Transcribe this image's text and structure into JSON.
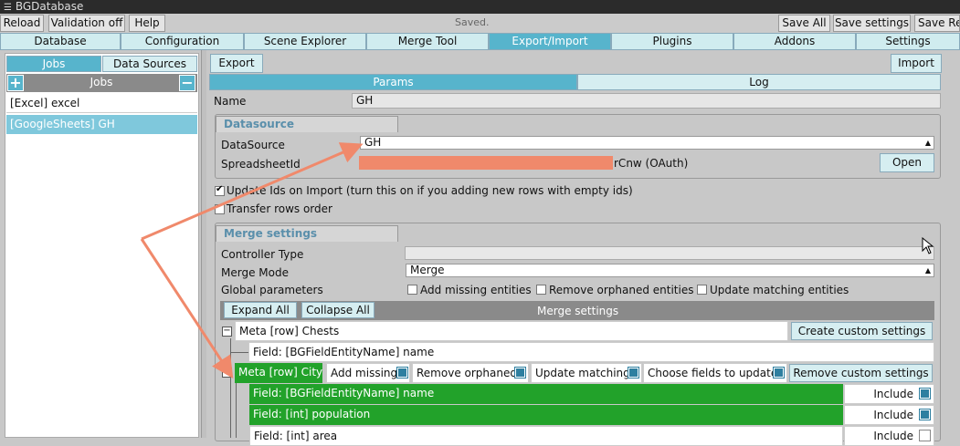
{
  "window": {
    "title": "BGDatabase"
  },
  "toolbar": {
    "reload": "Reload",
    "validation": "Validation off",
    "help": "Help",
    "status": "Saved.",
    "save_all": "Save All",
    "save_settings": "Save settings",
    "save_re": "Save Re"
  },
  "tabs": [
    "Database",
    "Configuration",
    "Scene Explorer",
    "Merge Tool",
    "Export/Import",
    "Plugins",
    "Addons",
    "Settings"
  ],
  "left": {
    "seg_jobs": "Jobs",
    "seg_sources": "Data Sources",
    "jobs_header": "Jobs",
    "add_icon": "plus-icon",
    "remove_icon": "minus-icon",
    "items": [
      "[Excel] excel",
      "[GoogleSheets] GH"
    ]
  },
  "main": {
    "export": "Export",
    "import": "Import",
    "params_tab": "Params",
    "log_tab": "Log",
    "name_label": "Name",
    "name_value": "GH",
    "datasource_group": "Datasource",
    "datasource_label": "DataSource",
    "datasource_value": "GH",
    "spreadsheet_label": "SpreadsheetId",
    "spreadsheet_suffix": "rCnw (OAuth)",
    "open": "Open",
    "update_ids": "Update Ids on Import (turn this on if you adding new rows with empty ids)",
    "transfer_rows": "Transfer rows order",
    "merge_group": "Merge settings",
    "controller_label": "Controller Type",
    "controller_value": "",
    "merge_mode_label": "Merge Mode",
    "merge_mode_value": "Merge",
    "global_label": "Global parameters",
    "global_opts": [
      "Add missing entities",
      "Remove orphaned entities",
      "Update matching entities"
    ],
    "expand_all": "Expand All",
    "collapse_all": "Collapse All",
    "merge_header": "Merge settings",
    "meta_chests": "Meta [row] Chests",
    "create_custom": "Create custom settings",
    "field_chests_name": "Field: [BGFieldEntityName] name",
    "meta_city": "Meta [row] City",
    "add_missing": "Add missing",
    "remove_orphaned": "Remove orphaned",
    "update_matching": "Update matching",
    "choose_fields": "Choose fields to update",
    "remove_custom": "Remove custom settings",
    "city_fields": [
      "Field: [BGFieldEntityName] name",
      "Field: [int] population",
      "Field: [int] area"
    ],
    "include": "Include"
  },
  "colors": {
    "accent": "#57b4cc",
    "green": "#22a22a",
    "arrow": "#f0896b"
  }
}
